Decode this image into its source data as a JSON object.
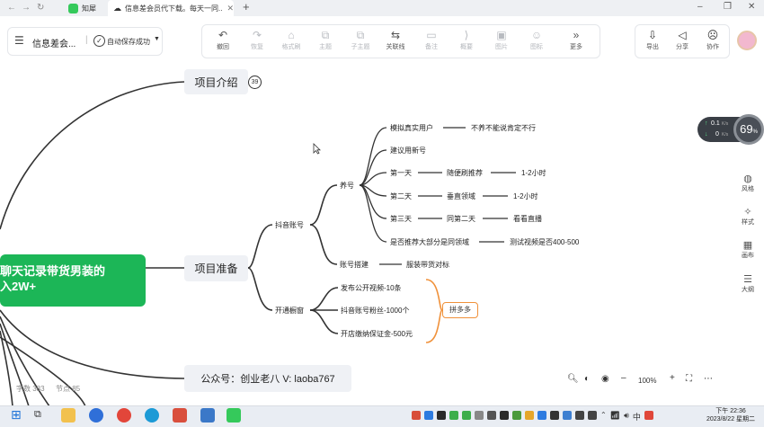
{
  "browser": {
    "tabs": [
      {
        "label": "知犀"
      },
      {
        "label": "信息差会员代下载。每天一同..."
      }
    ],
    "new_tab": "+"
  },
  "header": {
    "doc_title": "信息差会...",
    "autosave": "自动保存成功"
  },
  "toolbar": {
    "items": [
      {
        "label": "撤回",
        "icon": "undo-icon",
        "glyph": "↶"
      },
      {
        "label": "恢复",
        "icon": "redo-icon",
        "glyph": "↷"
      },
      {
        "label": "格式刷",
        "icon": "format-brush-icon",
        "glyph": "⌂"
      },
      {
        "label": "主题",
        "icon": "theme-icon",
        "glyph": "⧉"
      },
      {
        "label": "子主题",
        "icon": "subtheme-icon",
        "glyph": "⧉"
      },
      {
        "label": "关联线",
        "icon": "relation-line-icon",
        "glyph": "⇆"
      },
      {
        "label": "备注",
        "icon": "note-icon",
        "glyph": "▭"
      },
      {
        "label": "概要",
        "icon": "summary-icon",
        "glyph": "⟩"
      },
      {
        "label": "图片",
        "icon": "image-icon",
        "glyph": "▣"
      },
      {
        "label": "图标",
        "icon": "emoji-icon",
        "glyph": "☺"
      },
      {
        "label": "更多",
        "icon": "more-icon",
        "glyph": "»"
      }
    ],
    "right": [
      {
        "label": "导出",
        "icon": "export-icon",
        "glyph": "⇩"
      },
      {
        "label": "分享",
        "icon": "share-icon",
        "glyph": "◁"
      },
      {
        "label": "协作",
        "icon": "collaborate-icon",
        "glyph": "☹"
      }
    ]
  },
  "mindmap": {
    "root": {
      "line1": "聊天记录带货男装的",
      "line2": "入2W+"
    },
    "intro": {
      "label": "项目介绍",
      "badge": "39"
    },
    "prep": {
      "label": "项目准备"
    },
    "wechat": {
      "label": "公众号：创业老八  V: laoba767"
    },
    "douyin": "抖音账号",
    "yanghao": "养号",
    "leaves": {
      "moni": "模拟真实用户",
      "moni_note": "不养不能说肯定不行",
      "jianyi": "建议用新号",
      "day1": "第一天",
      "day1_a": "随便刷推荐",
      "day1_b": "1-2小时",
      "day2": "第二天",
      "day2_a": "垂直领域",
      "day2_b": "1-2小时",
      "day3": "第三天",
      "day3_a": "同第二天",
      "day3_b": "看看直播",
      "tuijian": "是否推荐大部分是同领域",
      "tuijian_note": "测试视频是否400-500",
      "zhanghao": "账号搭建",
      "zhanghao_note": "服装带货对标",
      "kaitong": "开通橱窗",
      "fabu": "发布公开视频-10条",
      "fensi": "抖音账号粉丝-1000个",
      "baozheng": "开店缴纳保证金-500元",
      "pinduoduo": "拼多多"
    }
  },
  "stats": {
    "words": "字数 383",
    "nodes": "节点 85"
  },
  "zoom": "100%",
  "net_widget": {
    "up": "0.1",
    "down": "0",
    "unit_up": "K/s",
    "unit_down": "K/s",
    "percent": "69"
  },
  "side_panel": [
    {
      "label": "风格",
      "icon": "palette-icon",
      "glyph": "◍"
    },
    {
      "label": "样式",
      "icon": "style-icon",
      "glyph": "✧"
    },
    {
      "label": "画布",
      "icon": "canvas-icon",
      "glyph": "▦"
    },
    {
      "label": "大纲",
      "icon": "outline-icon",
      "glyph": "☰"
    }
  ],
  "taskbar": {
    "time": "下午 22:36",
    "date": "2023/8/22 星期二",
    "ime": "中"
  },
  "colors": {
    "accent": "#1cb657",
    "summary_orange": "#f0913a",
    "node_bg": "#eff1f5"
  }
}
